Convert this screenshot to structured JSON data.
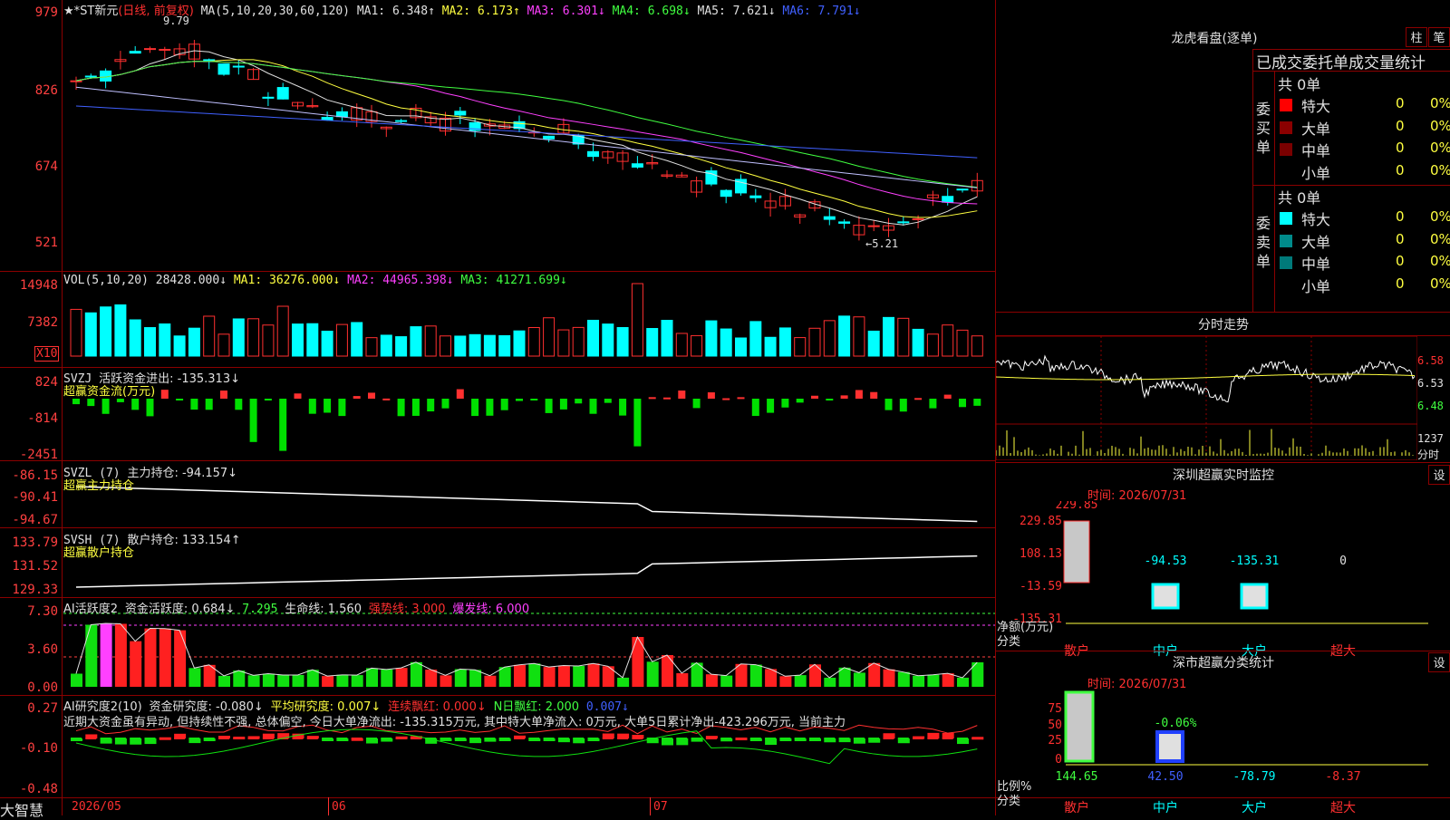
{
  "stock": {
    "name": "★*ST新元",
    "period": "(日线, 前复权)",
    "ma_label": "MA(5,10,20,30,60,120)",
    "ma1": "MA1: 6.348↑",
    "ma2": "MA2: 6.173↑",
    "ma3": "MA3: 6.301↓",
    "ma4": "MA4: 6.698↓",
    "ma5": "MA5: 7.621↓",
    "ma6": "MA6: 7.791↓",
    "high_mark": "9.79",
    "low_mark": "←5.21"
  },
  "price_axis": [
    "979",
    "826",
    "674",
    "521"
  ],
  "vol": {
    "label": "VOL(5,10,20)",
    "v": "28428.000↓",
    "ma1": "MA1: 36276.000↓",
    "ma2": "MA2: 44965.398↓",
    "ma3": "MA3: 41271.699↓",
    "axis": [
      "14948",
      "7382"
    ],
    "unit": "X10"
  },
  "svzj": {
    "label": "SVZJ",
    "text": "活跃资金进出: -135.313↓",
    "sub": "超赢资金流(万元)",
    "axis": [
      "824",
      "-814",
      "-2451"
    ]
  },
  "svzl": {
    "label": "SVZL (7)",
    "text": "主力持仓: -94.157↓",
    "sub": "超赢主力持仓",
    "axis": [
      "-86.15",
      "-90.41",
      "-94.67"
    ]
  },
  "svsh": {
    "label": "SVSH (7)",
    "text": "散户持仓: 133.154↑",
    "sub": "超赢散户持仓",
    "axis": [
      "133.79",
      "131.52",
      "129.33"
    ]
  },
  "ai1": {
    "label": "AI活跃度2",
    "t1": "资金活跃度: 0.684↓",
    "t2": "7.295",
    "t3": "生命线: 1.560",
    "t4": "强势线: 3.000",
    "t5": "爆发线: 6.000",
    "axis": [
      "7.30",
      "3.60",
      "0.00"
    ]
  },
  "ai2": {
    "label": "AI研究度2(10)",
    "t1": "资金研究度: -0.080↓",
    "t2": "平均研究度: 0.007↓",
    "t3": "连续飘红: 0.000↓",
    "t4": "N日飘红: 2.000",
    "t5": "0.007↓",
    "axis": [
      "0.27",
      "-0.10",
      "-0.48"
    ],
    "comment": "近期大资金虽有异动, 但持续性不强, 总体偏空, 今日大单净流出: -135.315万元, 其中特大单净流入: 0万元, 大单5日累计净出-423.296万元, 当前主力"
  },
  "dates": [
    "2026/05",
    "06",
    "07"
  ],
  "brand": "大智慧",
  "right": {
    "lh_title": "龙虎看盘(逐单)",
    "btn_zhu": "柱",
    "btn_bi": "笔",
    "tab_header": "已成交委托单成交量统计",
    "buy_side": "委买单",
    "sell_side": "委卖单",
    "buy_total": "共 0单",
    "sell_total": "共 0单",
    "buy_rows": [
      {
        "label": "特大",
        "value": "0",
        "pct": "0%",
        "color": "#ff0000"
      },
      {
        "label": "大单",
        "value": "0",
        "pct": "0%",
        "color": "#8b0000"
      },
      {
        "label": "中单",
        "value": "0",
        "pct": "0%",
        "color": "#7a0000"
      },
      {
        "label": "小单",
        "value": "0",
        "pct": "0%",
        "color": "#000000"
      }
    ],
    "sell_rows": [
      {
        "label": "特大",
        "value": "0",
        "pct": "0%",
        "color": "#00ffff"
      },
      {
        "label": "大单",
        "value": "0",
        "pct": "0%",
        "color": "#008b8b"
      },
      {
        "label": "中单",
        "value": "0",
        "pct": "0%",
        "color": "#007a7a"
      },
      {
        "label": "小单",
        "value": "0",
        "pct": "0%",
        "color": "#000000"
      }
    ],
    "fs_title": "分时走势",
    "fs_axis": [
      "6.58",
      "6.53",
      "6.48"
    ],
    "fs_vol": "1237",
    "fs_unit": "分时",
    "sz_title": "深圳超赢实时监控",
    "sz_btn": "设",
    "sz_time": "时间: 2026/07/31",
    "sz_axis": [
      "229.85",
      "108.13",
      "-13.59",
      "-135.31"
    ],
    "sz_ylabel": "净额(万元)",
    "sz_xlabel": "分类",
    "sz_vals": [
      "229.85",
      "-94.53",
      "-135.31",
      "0"
    ],
    "sz_cats": [
      "散户",
      "中户",
      "大户",
      "超大"
    ],
    "cls_title": "深市超赢分类统计",
    "cls_btn": "设",
    "cls_time": "时间: 2026/07/31",
    "cls_axis": [
      "75",
      "50",
      "25",
      "0"
    ],
    "cls_ylabel": "比例%",
    "cls_xlabel": "分类",
    "cls_vals": [
      "144.65",
      "42.50",
      "-78.79",
      "-8.37"
    ],
    "cls_mid": "-0.06%",
    "cls_cats": [
      "散户",
      "中户",
      "大户",
      "超大"
    ]
  }
}
